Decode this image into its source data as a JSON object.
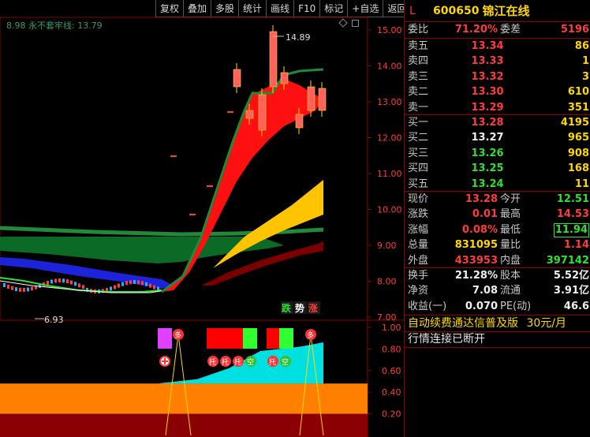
{
  "toolbar": {
    "items": [
      "复权",
      "叠加",
      "多股",
      "统计",
      "画线",
      "F10",
      "标记",
      "+自选",
      "返回"
    ]
  },
  "indicator": {
    "text": "8.98 永不套牢线: 13.79"
  },
  "header": {
    "marker": "L",
    "code": "600650",
    "name": "锦江在线"
  },
  "weibi": {
    "label": "委比",
    "value": "71.20%",
    "label2": "委差",
    "value2": "5196"
  },
  "asks": [
    {
      "label": "卖五",
      "price": "13.34",
      "vol": "86"
    },
    {
      "label": "卖四",
      "price": "13.33",
      "vol": "1"
    },
    {
      "label": "卖三",
      "price": "13.32",
      "vol": "3"
    },
    {
      "label": "卖二",
      "price": "13.30",
      "vol": "610"
    },
    {
      "label": "卖一",
      "price": "13.29",
      "vol": "351"
    }
  ],
  "bids": [
    {
      "label": "买一",
      "price": "13.28",
      "vol": "4195"
    },
    {
      "label": "买二",
      "price": "13.27",
      "vol": "965"
    },
    {
      "label": "买三",
      "price": "13.26",
      "vol": "908"
    },
    {
      "label": "买四",
      "price": "13.25",
      "vol": "168"
    },
    {
      "label": "买五",
      "price": "13.24",
      "vol": "11"
    }
  ],
  "quote": [
    {
      "l1": "现价",
      "v1": "13.28",
      "l2": "今开",
      "v2": "12.51"
    },
    {
      "l1": "涨跌",
      "v1": "0.01",
      "l2": "最高",
      "v2": "14.53"
    },
    {
      "l1": "涨幅",
      "v1": "0.08%",
      "l2": "最低",
      "v2": "11.94"
    },
    {
      "l1": "总量",
      "v1": "831095",
      "l2": "量比",
      "v2": "1.14"
    },
    {
      "l1": "外盘",
      "v1": "433953",
      "l2": "内盘",
      "v2": "397142"
    }
  ],
  "stats": [
    {
      "l1": "换手",
      "v1": "21.28%",
      "l2": "股本",
      "v2": "5.52亿"
    },
    {
      "l1": "净资",
      "v1": "7.08",
      "l2": "流通",
      "v2": "3.91亿"
    },
    {
      "l1": "收益(一)",
      "v1": "0.070",
      "l2": "PE(动)",
      "v2": "46.6"
    }
  ],
  "ad": {
    "text": "自动续费通达信普及版",
    "price": "30元/月"
  },
  "connection": {
    "text": "行情连接已断开"
  },
  "chart_data": [
    {
      "type": "candlestick",
      "title": "",
      "ylim": [
        6.8,
        15.3
      ],
      "yticks": [
        "15.00",
        "14.00",
        "13.00",
        "12.00",
        "11.00",
        "10.00",
        "9.00",
        "8.00",
        "7.00"
      ],
      "annotations": {
        "high": "14.89",
        "low": "6.93"
      },
      "signals": [
        "跌",
        "势",
        "涨"
      ]
    },
    {
      "type": "area",
      "title": "",
      "ylim": [
        0,
        1.05
      ],
      "yticks": [
        "1.00",
        "0.80",
        "0.60",
        "0.40",
        "0.20"
      ],
      "markers": [
        "多",
        "托",
        "托",
        "托",
        "空",
        "托",
        "空",
        "多"
      ]
    }
  ]
}
